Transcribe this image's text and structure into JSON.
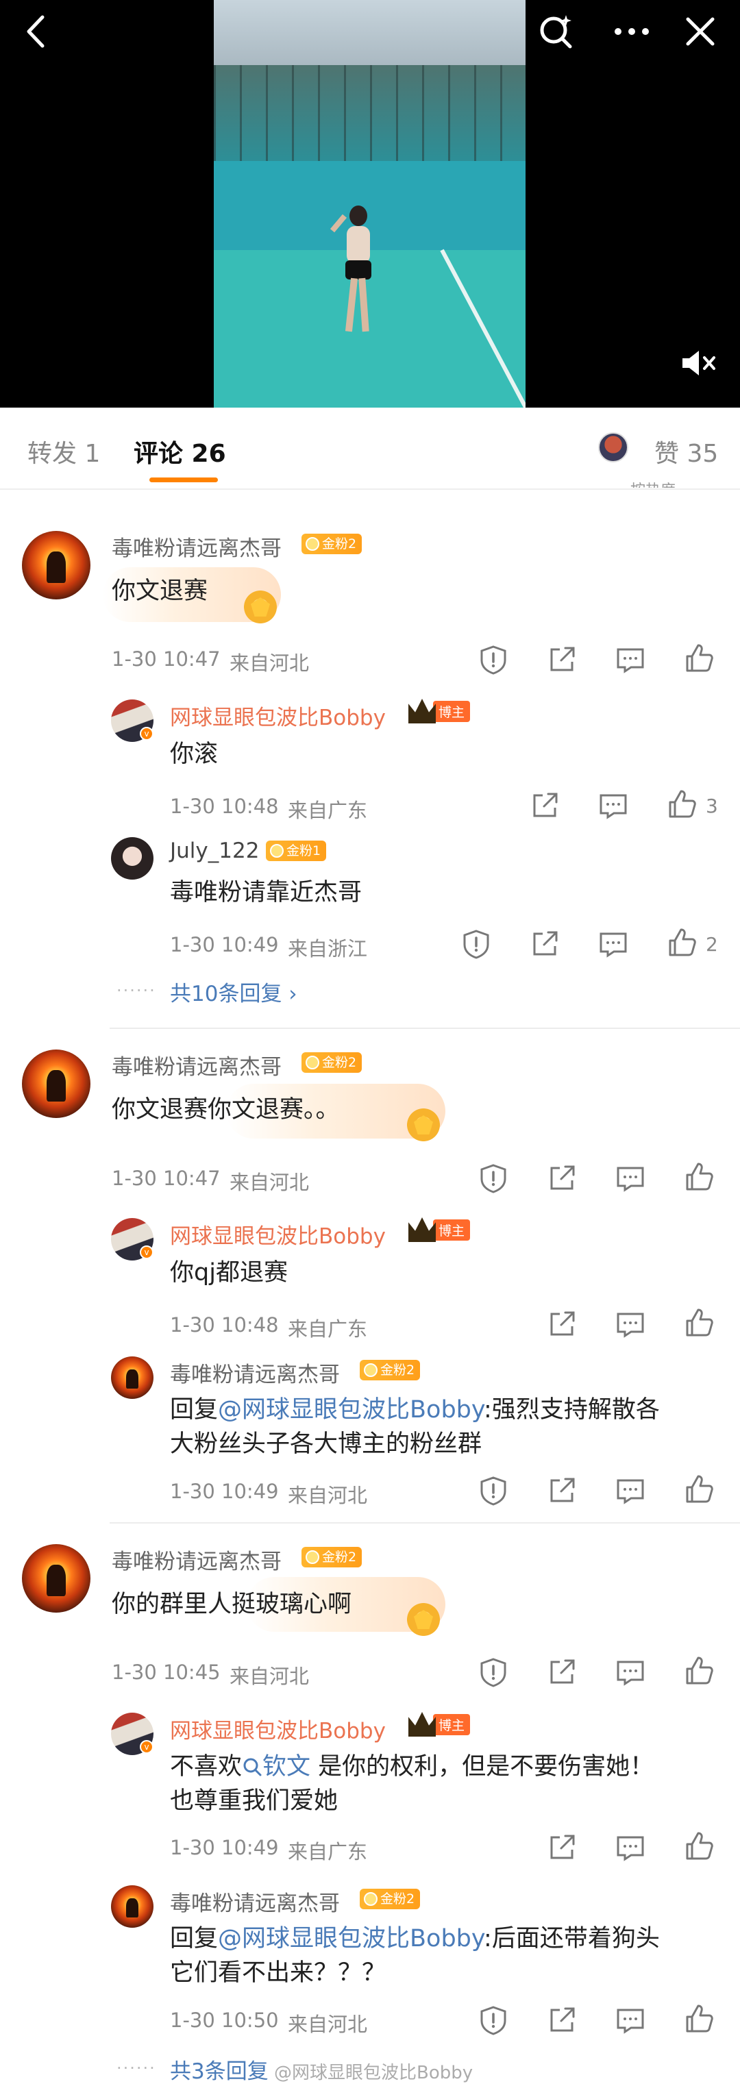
{
  "tabs": {
    "repost": "转发 1",
    "comment": "评论 26",
    "likes": "赞 35"
  },
  "subheader_peek": "按热度",
  "comments": [
    {
      "author": "毒唯粉请远离杰哥",
      "badge": "金粉2",
      "text": "你文退赛",
      "time": "1-30 10:47",
      "location": "来自河北",
      "replies": [
        {
          "author": "网球显眼包波比Bobby",
          "host_badge": "博主",
          "text": "你滚",
          "time": "1-30 10:48",
          "location": "来自广东",
          "likes": "3"
        },
        {
          "author": "July_122",
          "badge": "金粉1",
          "text": "毒唯粉请靠近杰哥",
          "time": "1-30 10:49",
          "location": "来自浙江",
          "likes": "2"
        }
      ],
      "more": "共10条回复 ›"
    },
    {
      "author": "毒唯粉请远离杰哥",
      "badge": "金粉2",
      "text": "你文退赛你文退赛。。",
      "time": "1-30 10:47",
      "location": "来自河北",
      "replies": [
        {
          "author": "网球显眼包波比Bobby",
          "host_badge": "博主",
          "text": "你qj都退赛",
          "time": "1-30 10:48",
          "location": "来自广东"
        },
        {
          "author": "毒唯粉请远离杰哥",
          "badge": "金粉2",
          "reply_prefix": "回复",
          "mention": "@网球显眼包波比Bobby",
          "text_line1": ":强烈支持解散各",
          "text_line2": "大粉丝头子各大博主的粉丝群",
          "time": "1-30 10:49",
          "location": "来自河北"
        }
      ]
    },
    {
      "author": "毒唯粉请远离杰哥",
      "badge": "金粉2",
      "text": "你的群里人挺玻璃心啊",
      "time": "1-30 10:45",
      "location": "来自河北",
      "replies": [
        {
          "author": "网球显眼包波比Bobby",
          "host_badge": "博主",
          "text_pre": "不喜欢",
          "topic": "钦文",
          "text_post": " 是你的权利，但是不要伤害她！",
          "text_line2": "也尊重我们爱她",
          "time": "1-30 10:49",
          "location": "来自广东"
        },
        {
          "author": "毒唯粉请远离杰哥",
          "badge": "金粉2",
          "reply_prefix": "回复",
          "mention": "@网球显眼包波比Bobby",
          "text_line1": ":后面还带着狗头",
          "text_line2": "它们看不出来？？？",
          "time": "1-30 10:50",
          "location": "来自河北"
        }
      ],
      "more": "共3条回复"
    }
  ],
  "watermark": "@网球显眼包波比Bobby",
  "icons": {
    "back": "chevron-left-icon",
    "search": "search-sparkle-icon",
    "more": "more-dots-icon",
    "close": "close-icon",
    "mute": "mute-icon",
    "report": "report-icon",
    "share": "share-icon",
    "comment": "comment-icon",
    "like": "like-icon"
  },
  "colors": {
    "accent": "#ff8200",
    "link": "#4a7bb8",
    "host_name": "#eb7350"
  }
}
